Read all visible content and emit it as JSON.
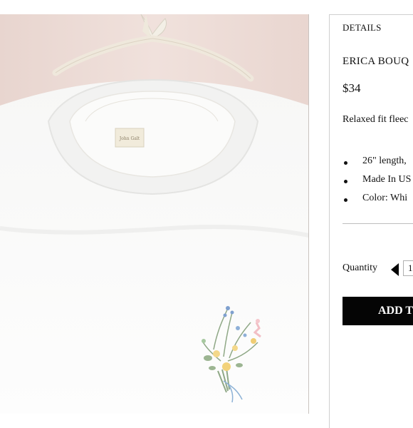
{
  "details_tab": "DETAILS",
  "product": {
    "title": "ERICA BOUQ",
    "price": "$34",
    "description": "Relaxed fit fleec",
    "bullets": [
      "26\" length,",
      "Made In US",
      "Color: Whi"
    ],
    "garment_label": "John Galt"
  },
  "quantity": {
    "label": "Quantity",
    "value": "1"
  },
  "add_button_label": "ADD T",
  "colors": {
    "photo_bg": "#ead8d3",
    "button_bg": "#050505",
    "text": "#111111"
  }
}
